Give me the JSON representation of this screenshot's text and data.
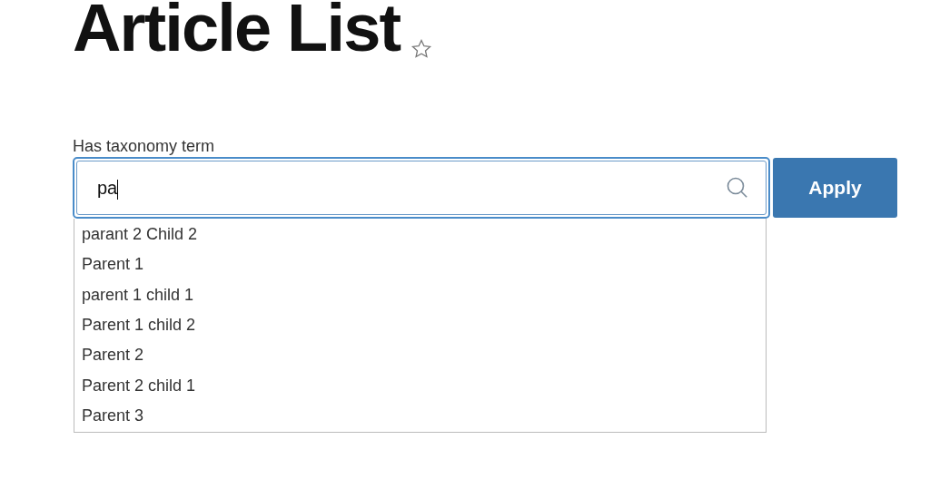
{
  "page": {
    "title": "Article List",
    "favorite": false
  },
  "filter": {
    "label": "Has taxonomy term",
    "value": "pa",
    "button": "Apply"
  },
  "suggestions": [
    {
      "label": "parant 2 Child 2"
    },
    {
      "label": "Parent 1"
    },
    {
      "label": "parent 1 child 1"
    },
    {
      "label": "Parent 1 child 2"
    },
    {
      "label": "Parent 2"
    },
    {
      "label": "Parent 2 child 1"
    },
    {
      "label": "Parent 3"
    }
  ]
}
